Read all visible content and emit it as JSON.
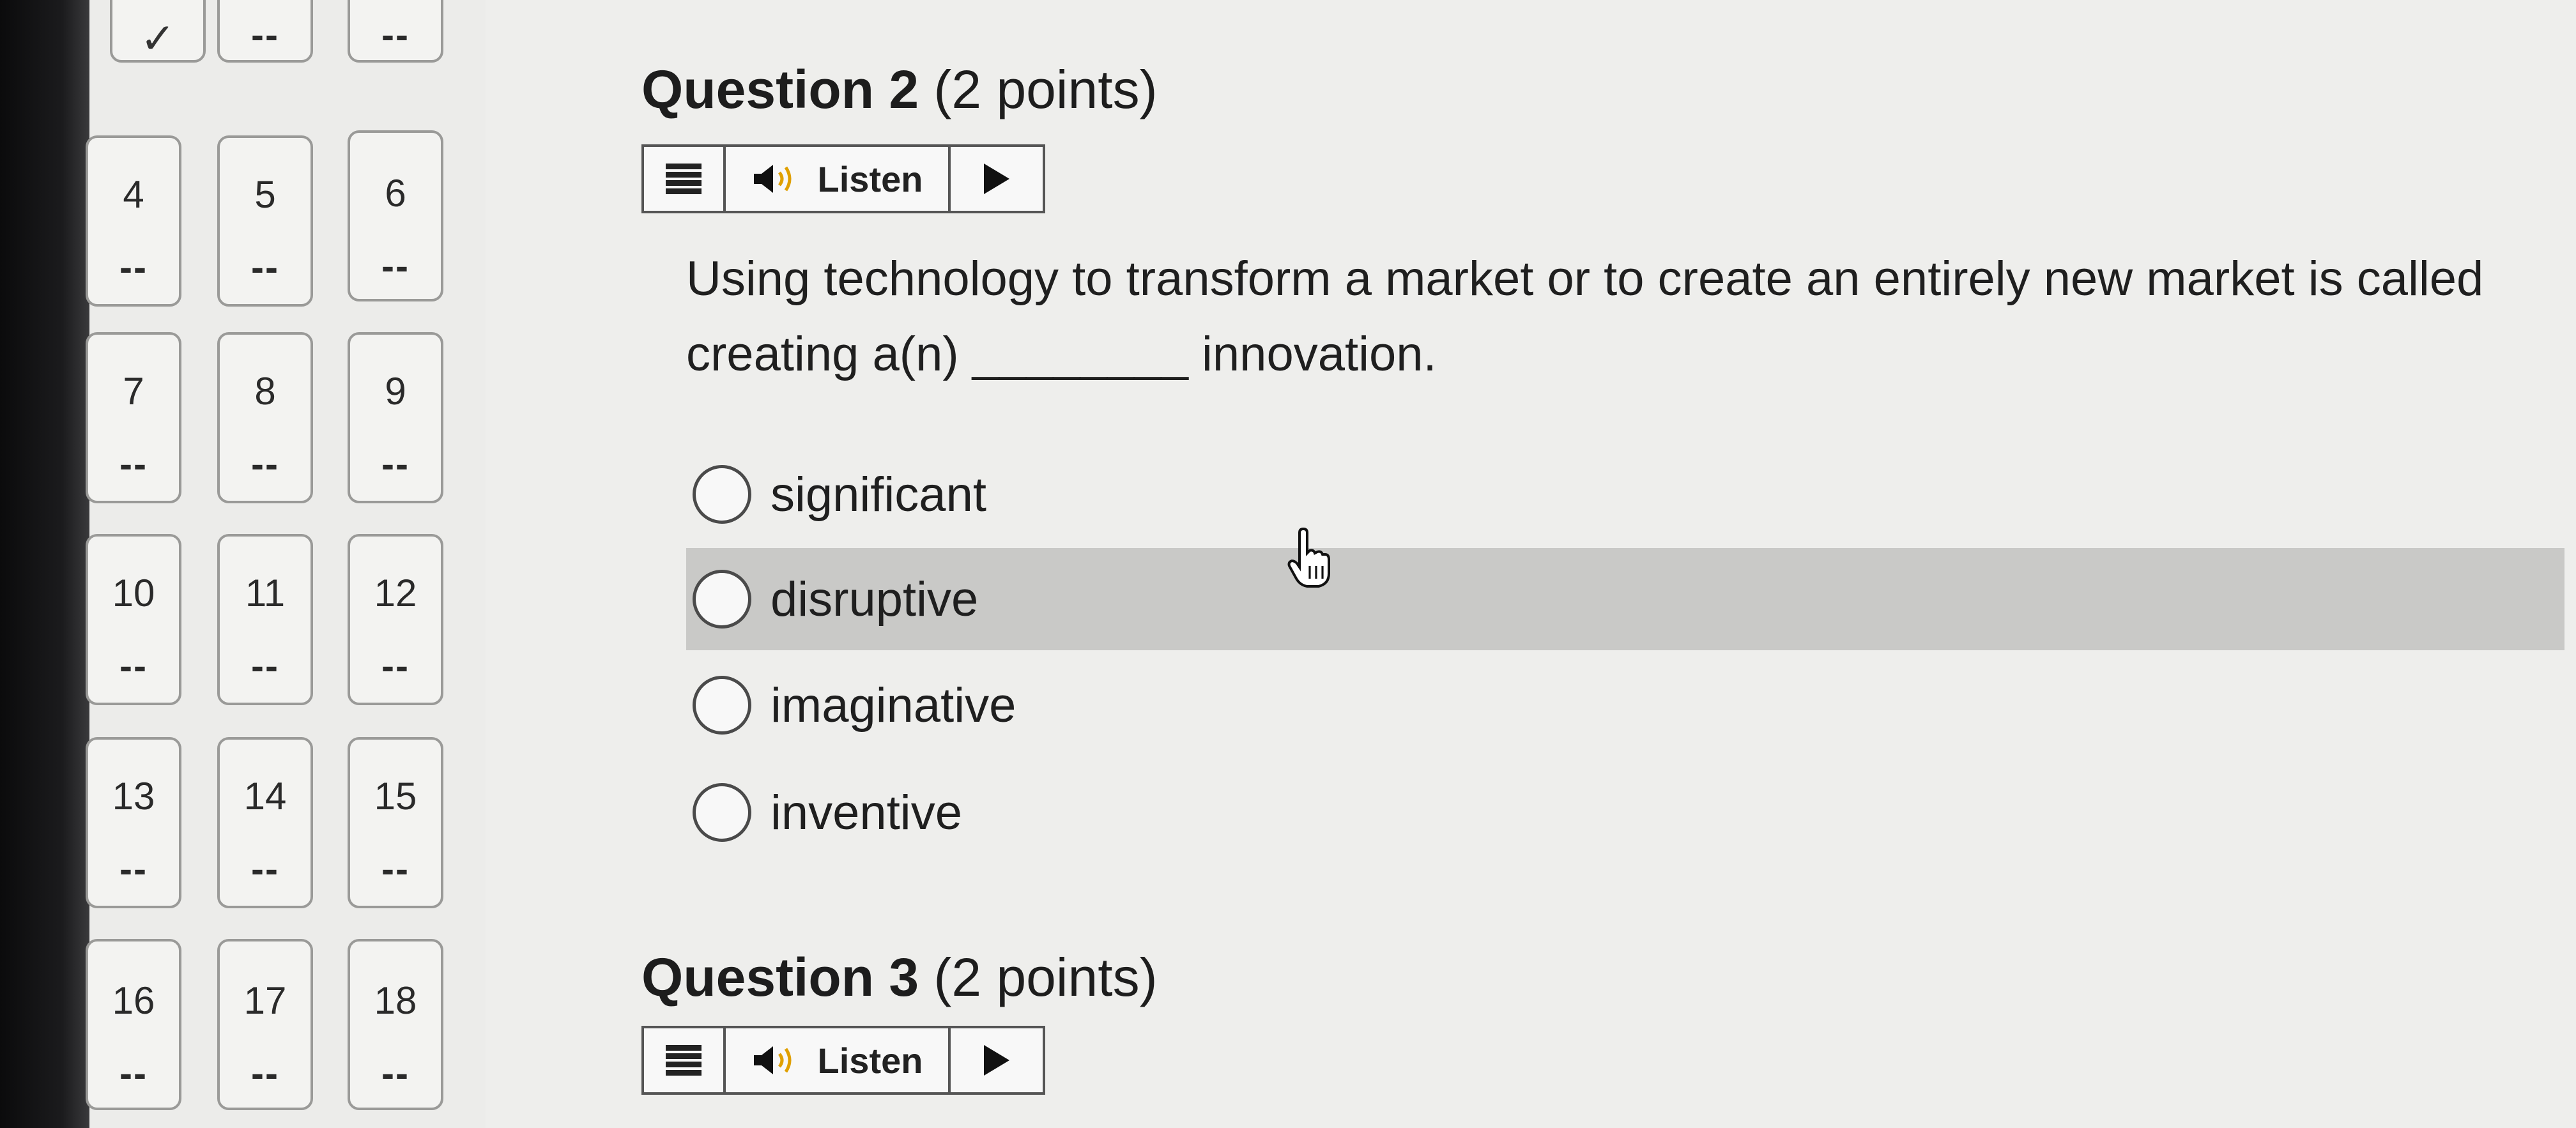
{
  "nav": {
    "top_row": [
      {
        "status": "✓"
      },
      {
        "status": "--"
      },
      {
        "status": "--"
      }
    ],
    "tiles": [
      {
        "num": "4",
        "status": "--"
      },
      {
        "num": "5",
        "status": "--"
      },
      {
        "num": "6",
        "status": "--"
      },
      {
        "num": "7",
        "status": "--"
      },
      {
        "num": "8",
        "status": "--"
      },
      {
        "num": "9",
        "status": "--"
      },
      {
        "num": "10",
        "status": "--"
      },
      {
        "num": "11",
        "status": "--"
      },
      {
        "num": "12",
        "status": "--"
      },
      {
        "num": "13",
        "status": "--"
      },
      {
        "num": "14",
        "status": "--"
      },
      {
        "num": "15",
        "status": "--"
      },
      {
        "num": "16",
        "status": "--"
      },
      {
        "num": "17",
        "status": "--"
      },
      {
        "num": "18",
        "status": "--"
      }
    ]
  },
  "question2": {
    "title_main": "Question 2",
    "title_points": "(2 points)",
    "listen_label": "Listen",
    "prompt": "Using technology to transform a market or to create an entirely new market is called creating a(n) ________ innovation.",
    "options": [
      "significant",
      "disruptive",
      "imaginative",
      "inventive"
    ],
    "hovered_option": "disruptive"
  },
  "question3": {
    "title_main": "Question 3",
    "title_points": "(2 points)",
    "listen_label": "Listen"
  },
  "icons": {
    "menu": "menu-icon",
    "speaker": "speaker-icon",
    "play": "play-icon",
    "check": "check-icon",
    "cursor": "hand-pointer-icon"
  },
  "colors": {
    "hover_row": "#c9c9c7",
    "border": "#555555"
  }
}
